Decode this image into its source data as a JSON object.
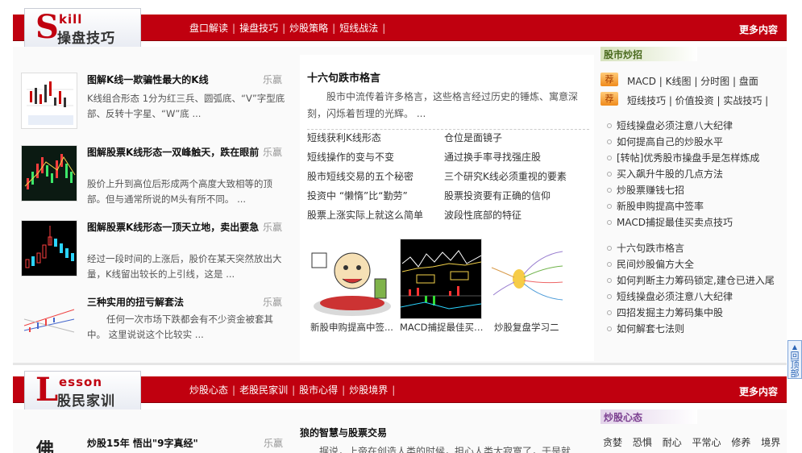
{
  "section_skill": {
    "en": "kill",
    "letter": "S",
    "cn": "操盘技巧",
    "nav": [
      "盘口解读",
      "操盘技巧",
      "炒股策略",
      "短线战法"
    ],
    "more": "更多内容"
  },
  "left_articles": [
    {
      "title": "图解K线一欺骗性最大的K线",
      "author": "乐赢",
      "desc": "K线组合形态  1分为红三兵、圆弧底、“V”字型底部、反转十字星、“W”底  ..."
    },
    {
      "title": "图解股票K线形态一双峰触天，跌在眼前",
      "author": "乐赢",
      "desc": "股价上升到高位后形成两个高度大致相等的顶部。但与通常所说的M头有所不同。  ..."
    },
    {
      "title": "图解股票K线形态一顶天立地，卖出要急",
      "author": "乐赢",
      "desc": "经过一段时间的上涨后，股价在某天突然放出大量，K线留出较长的上引线，这是  ..."
    },
    {
      "title": "三种实用的扭亏解套法",
      "author": "乐赢",
      "desc": "任何一次市场下跌都会有不少资金被套其中。      这里说说这个比较实  ..."
    }
  ],
  "middle": {
    "title": "十六句跌市格言",
    "desc": "股市中流传着许多格言，这些格言经过历史的锤炼、寓意深刻，闪烁着哲理的光辉。  ...",
    "links": [
      [
        "短线获利K线形态",
        "仓位是面镜子"
      ],
      [
        "短线操作的变与不变",
        "通过换手率寻找强庄股"
      ],
      [
        "股市短线交易的五个秘密",
        "三个研究K线必须重视的要素"
      ],
      [
        "投资中  “懒惰”比“勤劳”",
        "股票投资要有正确的信仰"
      ],
      [
        "股票上涨实际上就这么简单",
        "波段性底部的特征"
      ]
    ],
    "pictures": [
      {
        "caption": "新股申购提高中签..."
      },
      {
        "caption": "MACD捕捉最佳买卖..."
      },
      {
        "caption": "炒股复盘学习二"
      }
    ]
  },
  "right": {
    "header": "股市炒招",
    "badge": "荐",
    "rec_row_1": "MACD | K线图 | 分时图 |  盘面",
    "rec_row_2": "短线技巧 | 价值投资 | 实战技巧 |",
    "list_a": [
      "短线操盘必须注意八大纪律",
      "如何提高自己的炒股水平",
      "[转帖]优秀股市操盘手是怎样炼成",
      "买入飙升牛股的几点方法",
      "炒股票赚钱七招",
      "新股申购提高中签率",
      "MACD捕捉最佳买卖点技巧"
    ],
    "list_b": [
      "十六句跌市格言",
      "民间炒股偏方大全",
      "如何判断主力筹码锁定,建仓已进入尾",
      "短线操盘必须注意八大纪律",
      "四招发掘主力筹码集中股",
      "如何解套七法则"
    ]
  },
  "section_lesson": {
    "en": "esson",
    "letter": "L",
    "cn": "股民家训",
    "nav": [
      "炒股心态",
      "老股民家训",
      "股市心得",
      "炒股境界"
    ],
    "more": "更多内容"
  },
  "bottom": {
    "thumb_char": "佛",
    "title": "炒股15年  悟出\"9字真经\"",
    "author": "乐赢",
    "mid_title": "狼的智慧与股票交易",
    "mid_desc": "据说，上帝在创造人类的时候，担心人类太寂寞了，于是就",
    "right_header": "炒股心态",
    "right_cats": [
      "贪婪",
      "恐惧",
      "耐心",
      "平常心",
      "修养",
      "境界"
    ]
  },
  "back_to_top": [
    "回",
    "顶",
    "部"
  ]
}
